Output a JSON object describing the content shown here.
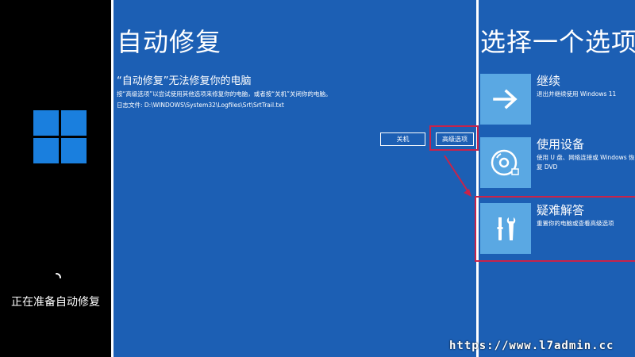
{
  "boot": {
    "status_text": "正在准备自动修复"
  },
  "repair": {
    "title": "自动修复",
    "subtitle": "“自动修复”无法修复你的电脑",
    "description": "按“高级选项”以尝试使用其他选项来修复你的电脑，或者按“关机”关闭你的电脑。",
    "log_file": "日志文件: D:\\WINDOWS\\System32\\Logfiles\\Srt\\SrtTrail.txt",
    "shutdown_label": "关机",
    "advanced_label": "高级选项"
  },
  "options": {
    "title": "选择一个选项",
    "items": [
      {
        "label": "继续",
        "description": "退出并继续使用 Windows 11",
        "icon": "arrow-right-icon"
      },
      {
        "label": "使用设备",
        "description": "使用 U 盘、网络连接或 Windows 恢复 DVD",
        "icon": "disc-icon"
      },
      {
        "label": "疑难解答",
        "description": "重置你的电脑或查看高级选项",
        "icon": "tools-icon"
      }
    ]
  },
  "watermark": "https://www.l7admin.cc",
  "colors": {
    "panel_blue": "#1c5fb4",
    "tile_blue": "#5aa8e3",
    "windows_blue": "#1a7fde",
    "highlight_red": "#c8234a"
  }
}
